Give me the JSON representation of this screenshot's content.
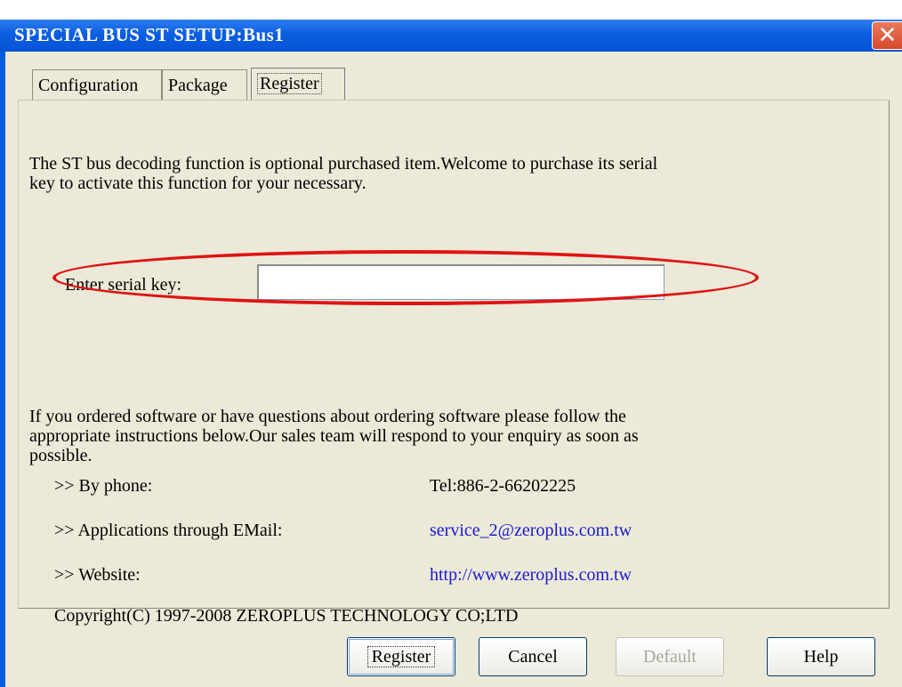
{
  "window": {
    "title": "SPECIAL BUS ST SETUP:Bus1",
    "close_glyph": "✕"
  },
  "tabs": [
    {
      "label": "Configuration"
    },
    {
      "label": "Package"
    },
    {
      "label": "Register",
      "active": true
    }
  ],
  "register": {
    "intro": "The ST bus decoding function is optional purchased item.Welcome to purchase its serial key to activate this function for your necessary.",
    "intro_line1": "The ST bus decoding function is optional purchased item.Welcome to purchase its serial",
    "intro_line2": "key to activate this function for your necessary.",
    "serial_label": "Enter serial key:",
    "serial_value": "",
    "info_line1": "If you ordered software or have questions about ordering software please follow the",
    "info_line2": "appropriate instructions below.Our sales team will respond to your enquiry as soon as",
    "info_line3": "possible.",
    "contacts": [
      {
        "label": ">> By phone:",
        "value": "Tel:886-2-66202225"
      },
      {
        "label": ">> Applications through EMail:",
        "value": "service_2@zeroplus.com.tw"
      },
      {
        "label": ">> Website:",
        "value": "http://www.zeroplus.com.tw"
      }
    ],
    "copyright": "Copyright(C) 1997-2008 ZEROPLUS TECHNOLOGY CO;LTD"
  },
  "buttons": {
    "register": "Register",
    "cancel": "Cancel",
    "default": "Default",
    "help": "Help"
  },
  "colors": {
    "titlebar": "#0b5ee0",
    "client_bg": "#ece9d8",
    "link": "#1a1acd",
    "highlight_ellipse": "#e01313"
  }
}
